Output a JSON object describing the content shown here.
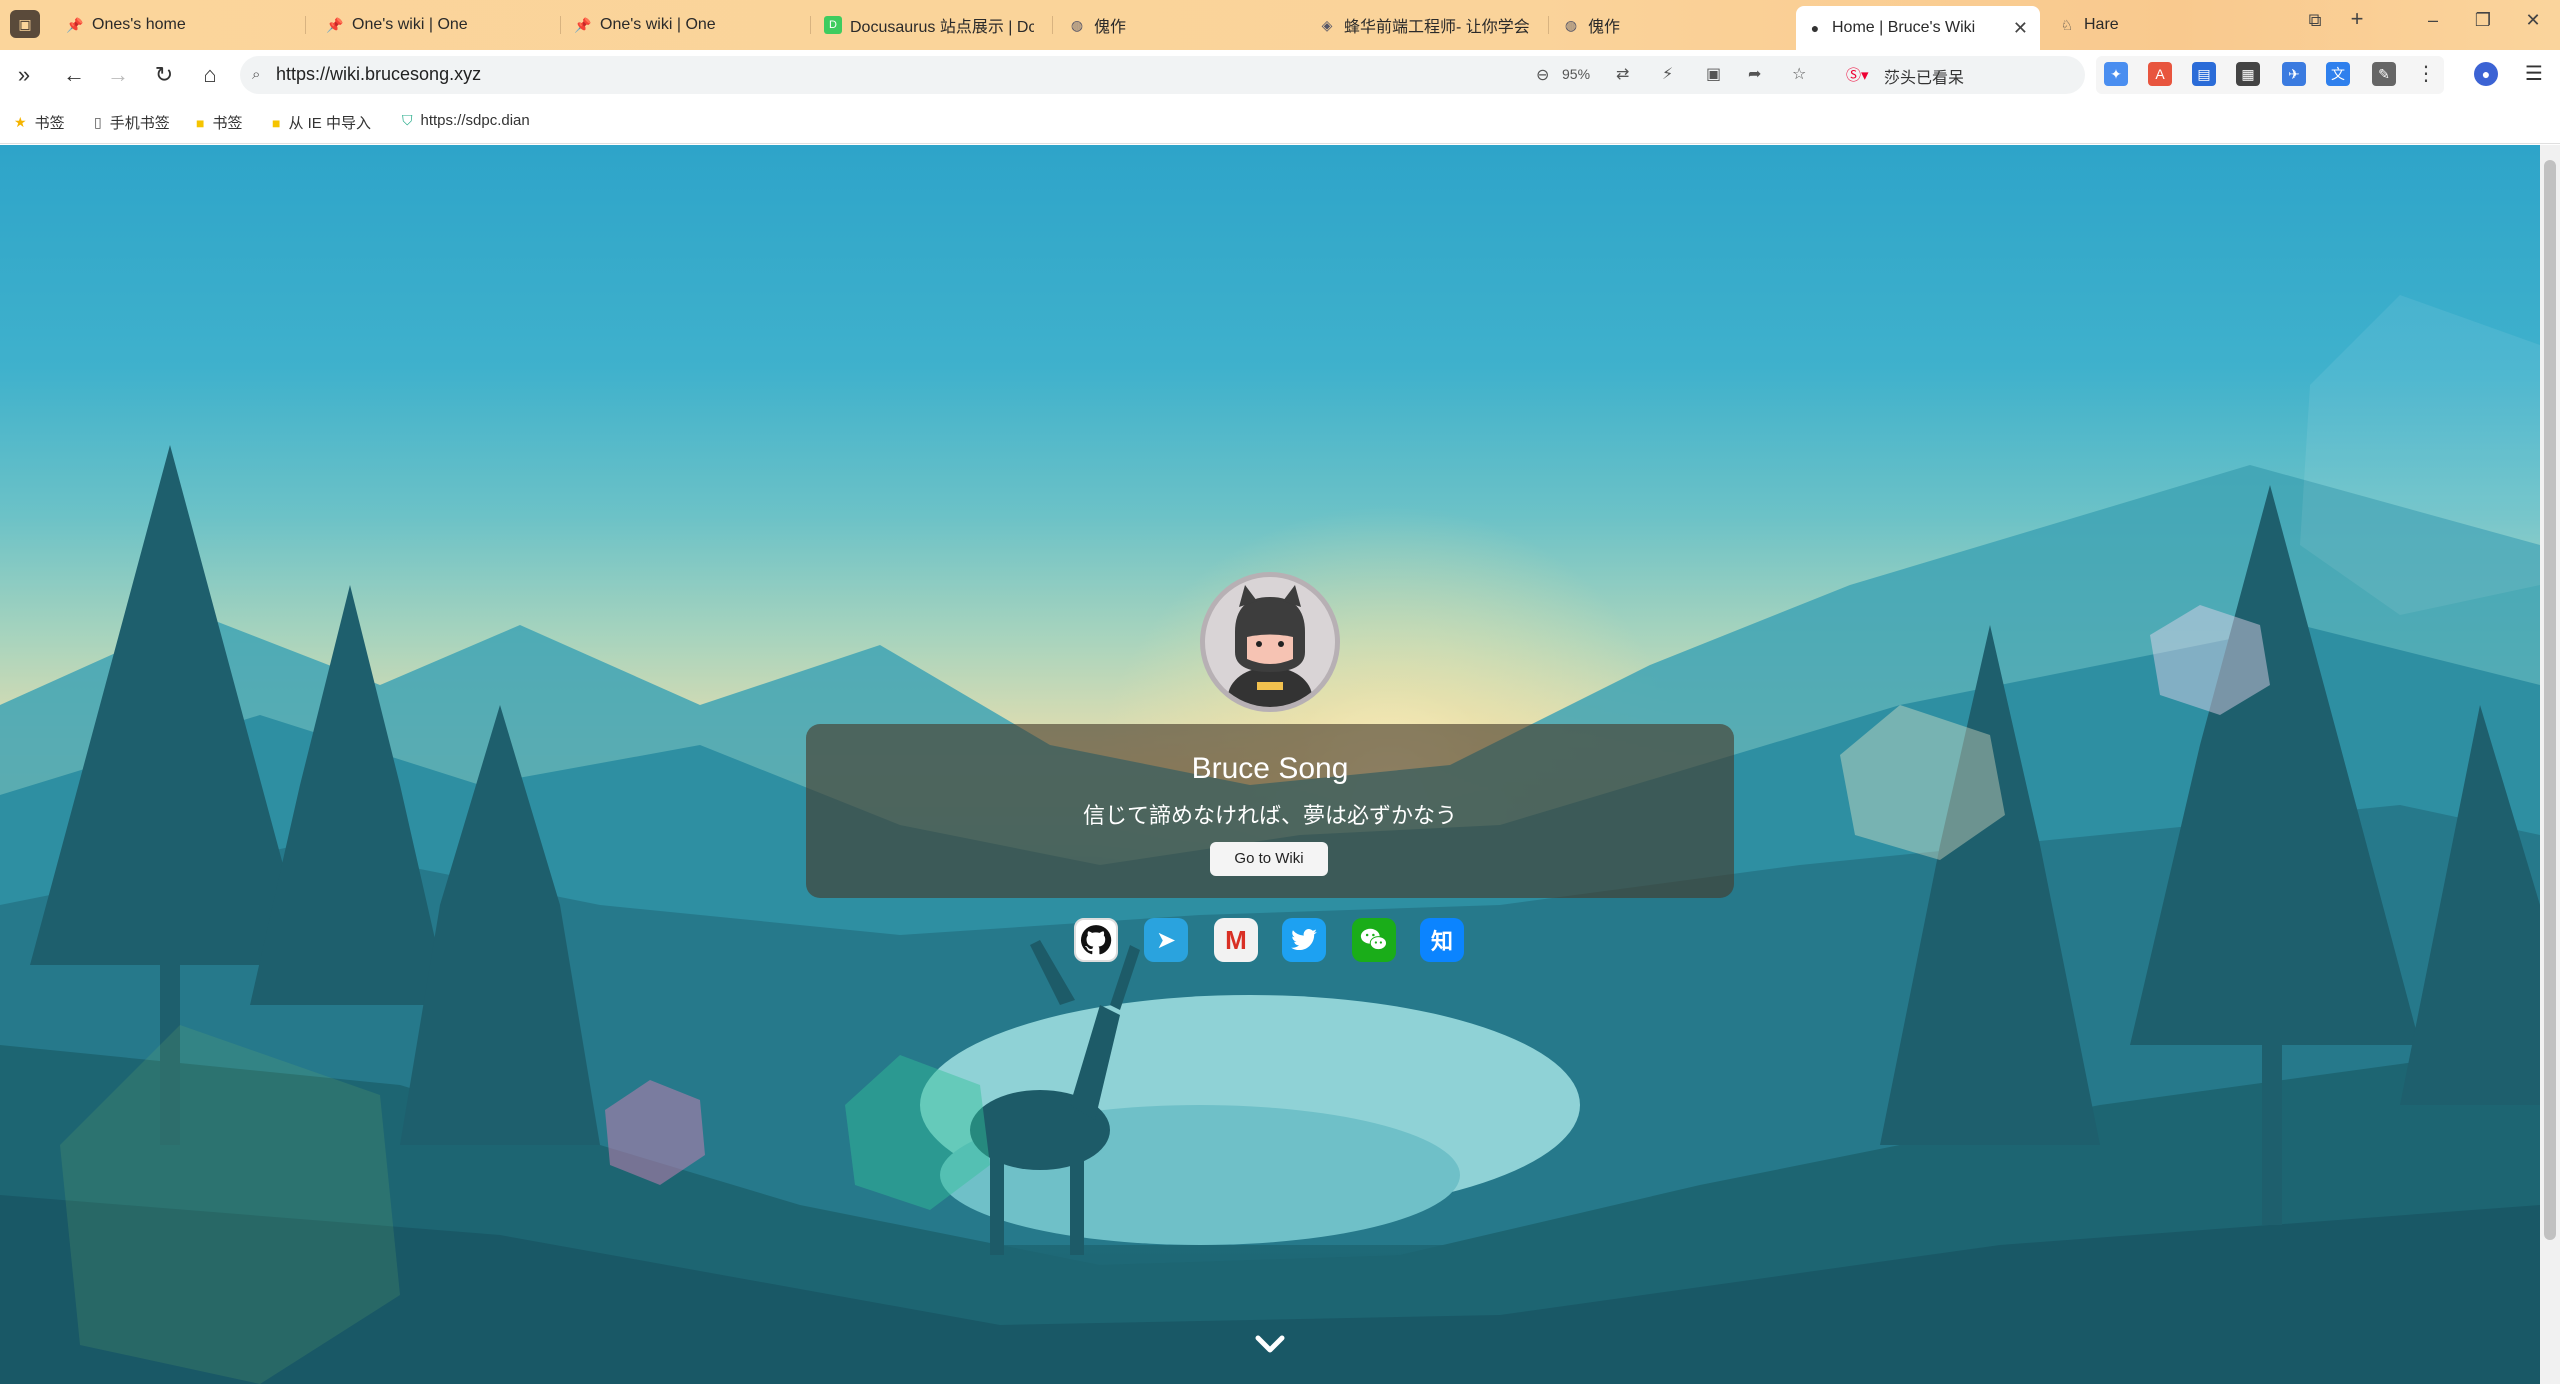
{
  "tabs": [
    {
      "label": "Ones's home"
    },
    {
      "label": "One's wiki | One"
    },
    {
      "label": "One's wiki | One"
    },
    {
      "label": "Docusaurus 站点展示 | Dc"
    },
    {
      "label": "傀作"
    },
    {
      "label": "蜂华前端工程师- 让你学会"
    },
    {
      "label": "傀作"
    },
    {
      "label": "Home | Bruce's Wiki"
    },
    {
      "label": "Hare"
    }
  ],
  "toolbar": {
    "url": "https://wiki.brucesong.xyz",
    "zoom": "95%",
    "search_engine_label": "莎头已看呆"
  },
  "bookmarks": [
    {
      "label": "书签"
    },
    {
      "label": "手机书签"
    },
    {
      "label": "书签"
    },
    {
      "label": "从 IE 中导入"
    },
    {
      "label": "https://sdpc.dian"
    }
  ],
  "hero": {
    "name": "Bruce Song",
    "motto": "信じて諦めなければ、夢は必ずかなう",
    "button": "Go to Wiki",
    "zhihu_glyph": "知"
  },
  "colors": {
    "accent_tabbar": "#fbd59b",
    "card_bg": "rgba(70,58,42,0.62)"
  }
}
